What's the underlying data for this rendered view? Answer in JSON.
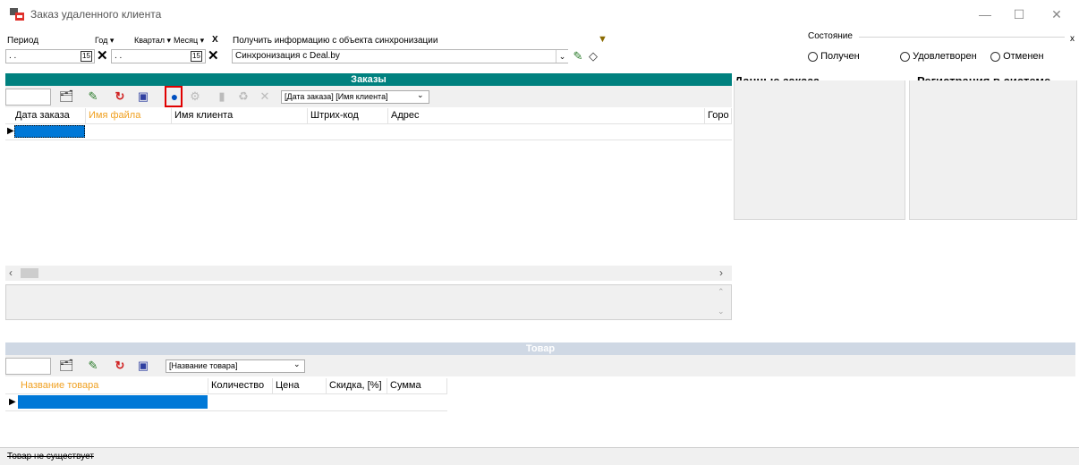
{
  "window": {
    "title": "Заказ удаленного клиента"
  },
  "period": {
    "label": "Период",
    "year": "Год ▾",
    "quarter": "Квартал ▾",
    "month": "Месяц ▾",
    "clear": "X",
    "date_from": ". .",
    "date_to": ". ."
  },
  "sync": {
    "label": "Получить информацию с объекта синхронизации",
    "value": "Синхронизация с Deal.by"
  },
  "state": {
    "label": "Состояние",
    "close": "x",
    "options": [
      "Получен",
      "Удовлетворен",
      "Отменен"
    ]
  },
  "orders": {
    "title": "Заказы",
    "sort_combo": "[Дата заказа] [Имя клиента]",
    "columns": [
      "Дата заказа",
      "Имя файла",
      "Имя клиента",
      "Штрих-код",
      "Адрес",
      "Горо"
    ]
  },
  "order_data_title": "Данные заказа",
  "registration_title": "Регистрация в системе",
  "goods": {
    "title": "Товар",
    "sort_combo": "[Название товара]",
    "columns": [
      "Название товара",
      "Количество",
      "Цена",
      "Скидка, [%]",
      "Сумма"
    ]
  },
  "status": {
    "text": "Товар не существует"
  },
  "colors": {
    "accent_teal": "#00817f",
    "selection": "#0078d7",
    "highlight_border": "#e00000",
    "orange_column": "#f0a020"
  }
}
